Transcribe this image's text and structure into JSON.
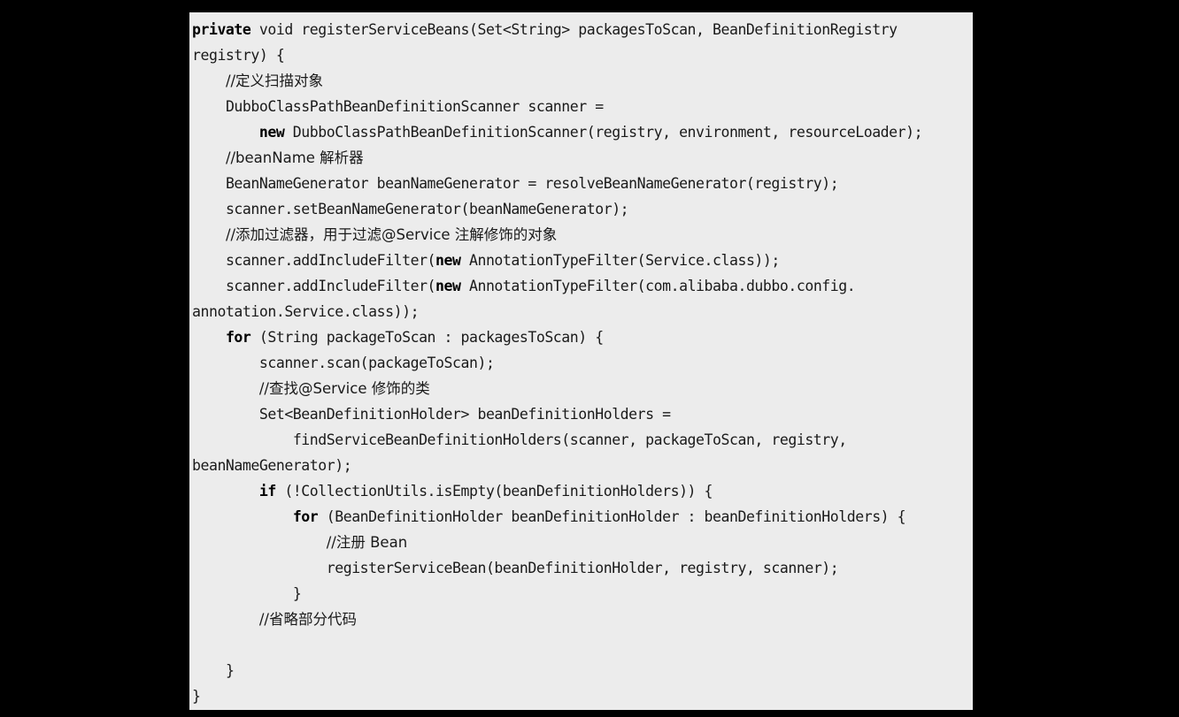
{
  "code_block": {
    "lines": [
      {
        "indent": "",
        "parts": [
          {
            "t": "private",
            "kw": true
          },
          {
            "t": " void registerServiceBeans(Set<String> packagesToScan, BeanDefinitionRegistry"
          }
        ]
      },
      {
        "indent": "",
        "parts": [
          {
            "t": "registry) {"
          }
        ]
      },
      {
        "indent": "    ",
        "parts": [
          {
            "t": "//定义扫描对象",
            "cm": true
          }
        ]
      },
      {
        "indent": "    ",
        "parts": [
          {
            "t": "DubboClassPathBeanDefinitionScanner scanner ="
          }
        ]
      },
      {
        "indent": "        ",
        "parts": [
          {
            "t": "new",
            "kw": true
          },
          {
            "t": " DubboClassPathBeanDefinitionScanner(registry, environment, resourceLoader);"
          }
        ]
      },
      {
        "indent": "    ",
        "parts": [
          {
            "t": "//beanName 解析器",
            "cm": true
          }
        ]
      },
      {
        "indent": "    ",
        "parts": [
          {
            "t": "BeanNameGenerator beanNameGenerator = resolveBeanNameGenerator(registry);"
          }
        ]
      },
      {
        "indent": "    ",
        "parts": [
          {
            "t": "scanner.setBeanNameGenerator(beanNameGenerator);"
          }
        ]
      },
      {
        "indent": "    ",
        "parts": [
          {
            "t": "//添加过滤器，用于过滤@Service 注解修饰的对象",
            "cm": true
          }
        ]
      },
      {
        "indent": "    ",
        "parts": [
          {
            "t": "scanner.addIncludeFilter("
          },
          {
            "t": "new",
            "kw": true
          },
          {
            "t": " AnnotationTypeFilter(Service.class));"
          }
        ]
      },
      {
        "indent": "    ",
        "parts": [
          {
            "t": "scanner.addIncludeFilter("
          },
          {
            "t": "new",
            "kw": true
          },
          {
            "t": " AnnotationTypeFilter(com.alibaba.dubbo.config."
          }
        ]
      },
      {
        "indent": "",
        "parts": [
          {
            "t": "annotation.Service.class));"
          }
        ]
      },
      {
        "indent": "    ",
        "parts": [
          {
            "t": "for",
            "kw": true
          },
          {
            "t": " (String packageToScan : packagesToScan) {"
          }
        ]
      },
      {
        "indent": "        ",
        "parts": [
          {
            "t": "scanner.scan(packageToScan);"
          }
        ]
      },
      {
        "indent": "        ",
        "parts": [
          {
            "t": "//查找@Service 修饰的类",
            "cm": true
          }
        ]
      },
      {
        "indent": "        ",
        "parts": [
          {
            "t": "Set<BeanDefinitionHolder> beanDefinitionHolders ="
          }
        ]
      },
      {
        "indent": "            ",
        "parts": [
          {
            "t": "findServiceBeanDefinitionHolders(scanner, packageToScan, registry,"
          }
        ]
      },
      {
        "indent": "",
        "parts": [
          {
            "t": "beanNameGenerator);"
          }
        ]
      },
      {
        "indent": "        ",
        "parts": [
          {
            "t": "if",
            "kw": true
          },
          {
            "t": " (!CollectionUtils.isEmpty(beanDefinitionHolders)) {"
          }
        ]
      },
      {
        "indent": "            ",
        "parts": [
          {
            "t": "for",
            "kw": true
          },
          {
            "t": " (BeanDefinitionHolder beanDefinitionHolder : beanDefinitionHolders) {"
          }
        ]
      },
      {
        "indent": "                ",
        "parts": [
          {
            "t": "//注册 Bean",
            "cm": true
          }
        ]
      },
      {
        "indent": "                ",
        "parts": [
          {
            "t": "registerServiceBean(beanDefinitionHolder, registry, scanner);"
          }
        ]
      },
      {
        "indent": "            ",
        "parts": [
          {
            "t": "}"
          }
        ]
      },
      {
        "indent": "        ",
        "parts": [
          {
            "t": "//省略部分代码",
            "cm": true
          }
        ]
      },
      {
        "indent": "",
        "parts": [
          {
            "t": ""
          }
        ]
      },
      {
        "indent": "    ",
        "parts": [
          {
            "t": "}"
          }
        ]
      },
      {
        "indent": "",
        "parts": [
          {
            "t": "}"
          }
        ]
      }
    ]
  }
}
